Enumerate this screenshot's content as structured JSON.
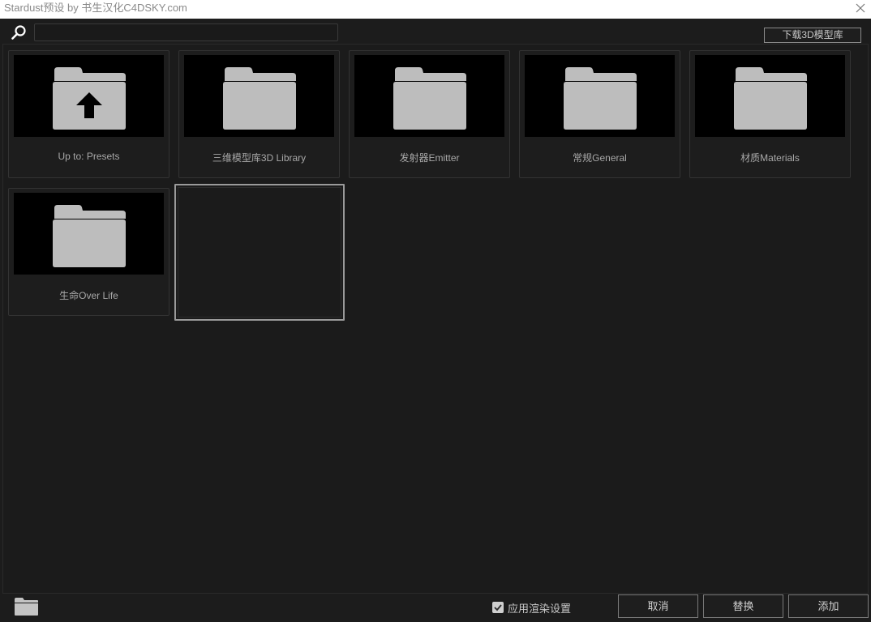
{
  "window": {
    "title": "Stardust预设 by 书生汉化C4DSKY.com",
    "close_icon": "close-icon"
  },
  "toolbar": {
    "search_icon": "search-icon",
    "search_value": "",
    "download_label": "下载3D模型库"
  },
  "tiles": [
    {
      "label": "Up to: Presets",
      "icon": "folder-up-icon"
    },
    {
      "label": "三维模型库3D Library",
      "icon": "folder-icon"
    },
    {
      "label": "发射器Emitter",
      "icon": "folder-icon"
    },
    {
      "label": "常规General",
      "icon": "folder-icon"
    },
    {
      "label": "材质Materials",
      "icon": "folder-icon"
    },
    {
      "label": "生命Over Life",
      "icon": "folder-icon"
    }
  ],
  "footer": {
    "folder_icon": "folder-icon",
    "apply_render_label": "应用渲染设置",
    "apply_render_checked": true,
    "cancel_label": "取消",
    "replace_label": "替换",
    "add_label": "添加"
  },
  "colors": {
    "background": "#1c1c1c",
    "folder": "#bdbdbd",
    "thumb_bg": "#000000",
    "text": "#a8a8a8",
    "selected_border": "#9a9a9a"
  }
}
